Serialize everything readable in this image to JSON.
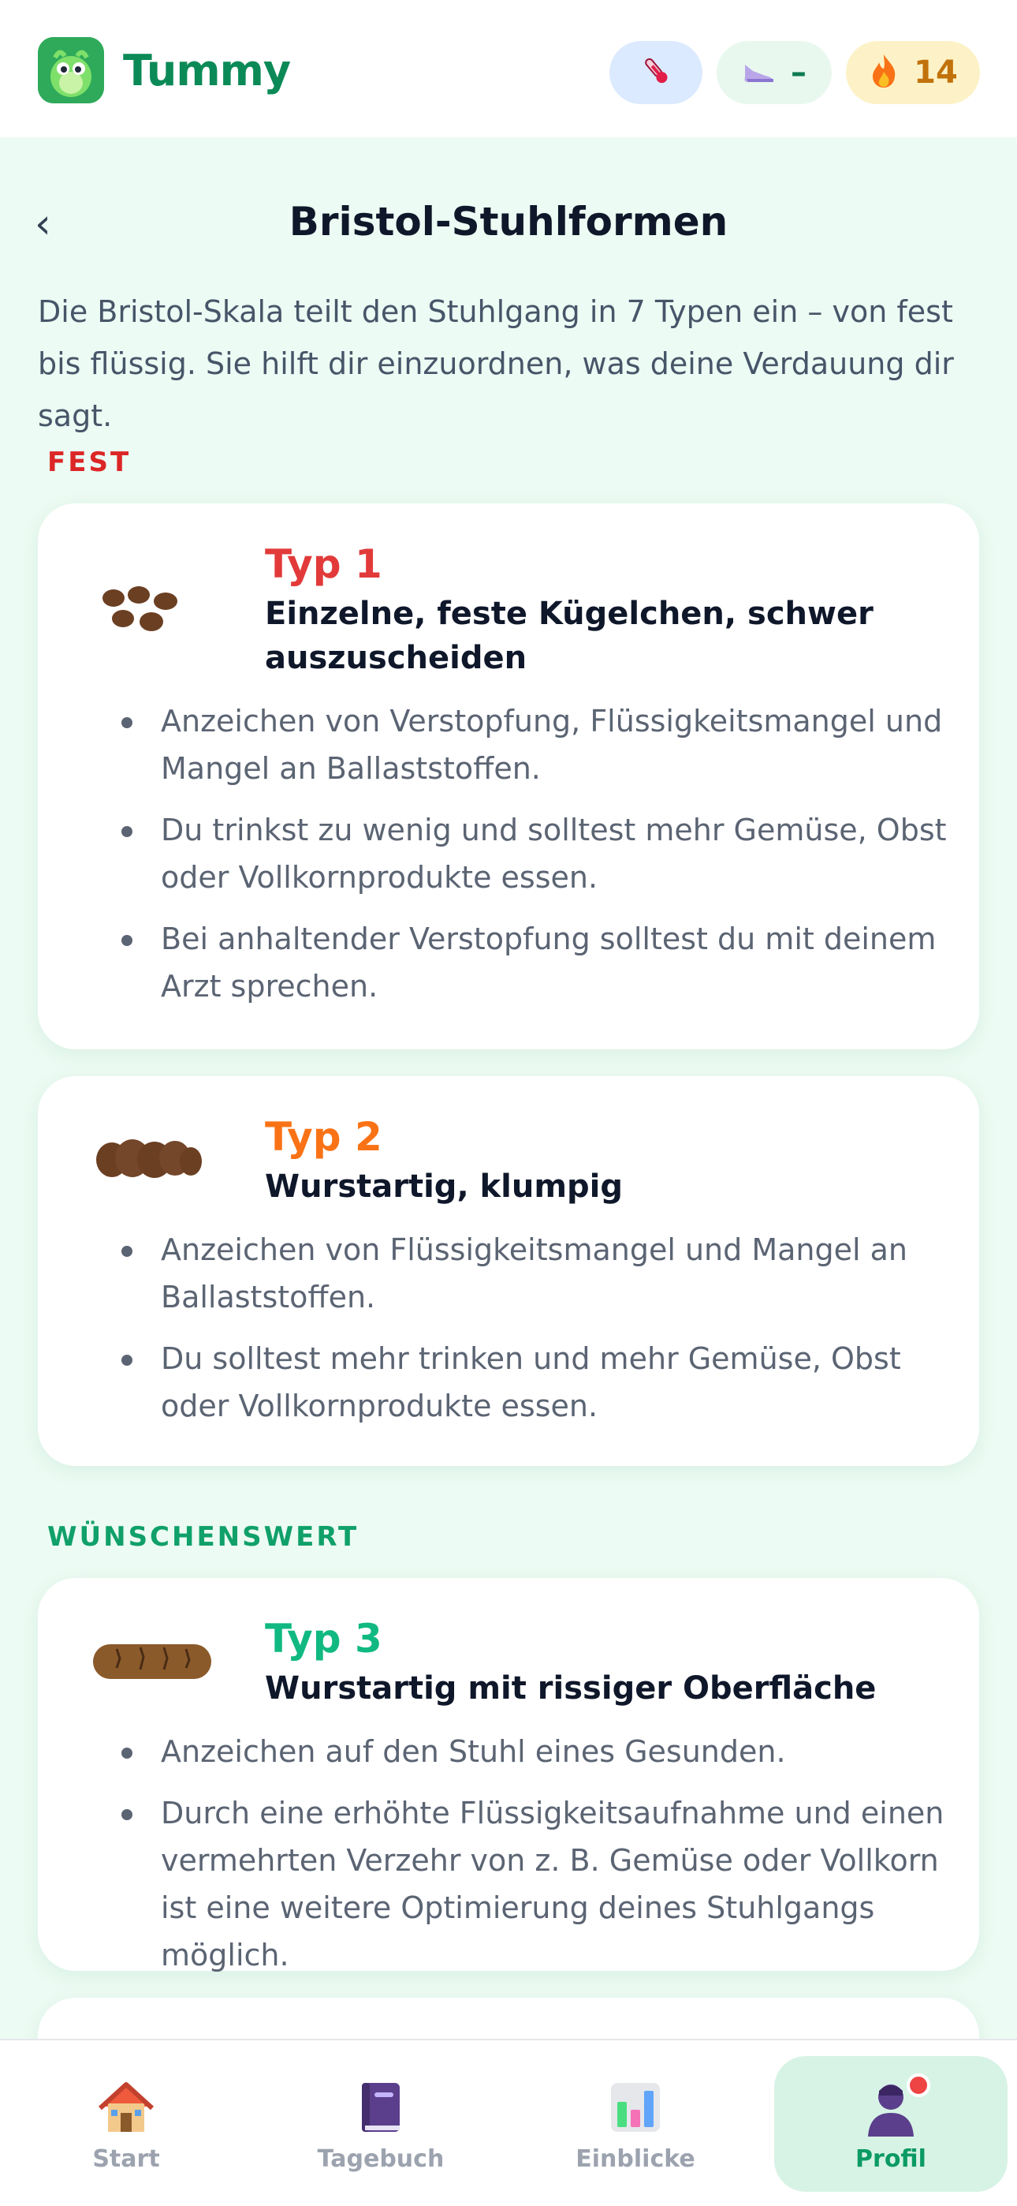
{
  "app": {
    "name": "Tummy",
    "status_pills": [
      {
        "icon": "thermometer-icon",
        "value": ""
      },
      {
        "icon": "sneaker-icon",
        "value": "–"
      },
      {
        "icon": "flame-icon",
        "value": "14"
      }
    ]
  },
  "header": {
    "back_label": "‹",
    "title": "Bristol-Stuhlformen"
  },
  "intro": "Die Bristol-Skala teilt den Stuhlgang in 7 Typen ein – von fest bis flüssig. Sie hilft dir einzuordnen, was deine Verdauung dir sagt.",
  "sections": {
    "fest": "FEST",
    "wuenschenswert": "WÜNSCHENSWERT"
  },
  "cards": [
    {
      "type_label": "Typ 1",
      "description": "Einzelne, feste Kügelchen, schwer auszuscheiden",
      "color": "#e23a3a",
      "bullets": [
        "Anzeichen von Verstopfung, Flüssigkeitsmangel und Mangel an Ballaststoffen.",
        "Du trinkst zu wenig und solltest mehr Gemüse, Obst oder Vollkornprodukte essen.",
        "Bei anhaltender Verstopfung solltest du mit deinem Arzt sprechen."
      ]
    },
    {
      "type_label": "Typ 2",
      "description": "Wurstartig, klumpig",
      "color": "#f97316",
      "bullets": [
        "Anzeichen von Flüssigkeitsmangel und Mangel an Ballaststoffen.",
        "Du solltest mehr trinken und mehr Gemüse, Obst oder Vollkornprodukte essen."
      ]
    },
    {
      "type_label": "Typ 3",
      "description": "Wurstartig mit rissiger Oberfläche",
      "color": "#10b981",
      "bullets": [
        "Anzeichen auf den Stuhl eines Gesunden.",
        "Durch eine erhöhte Flüssigkeitsaufnahme und einen vermehrten Verzehr von z. B. Gemüse oder Vollkorn ist eine weitere Optimierung deines Stuhlgangs möglich."
      ]
    }
  ],
  "nav": {
    "items": [
      {
        "label": "Start",
        "icon": "house-icon",
        "active": false
      },
      {
        "label": "Tagebuch",
        "icon": "book-icon",
        "active": false
      },
      {
        "label": "Einblicke",
        "icon": "bar-chart-icon",
        "active": false
      },
      {
        "label": "Profil",
        "icon": "person-icon",
        "active": true
      }
    ]
  }
}
